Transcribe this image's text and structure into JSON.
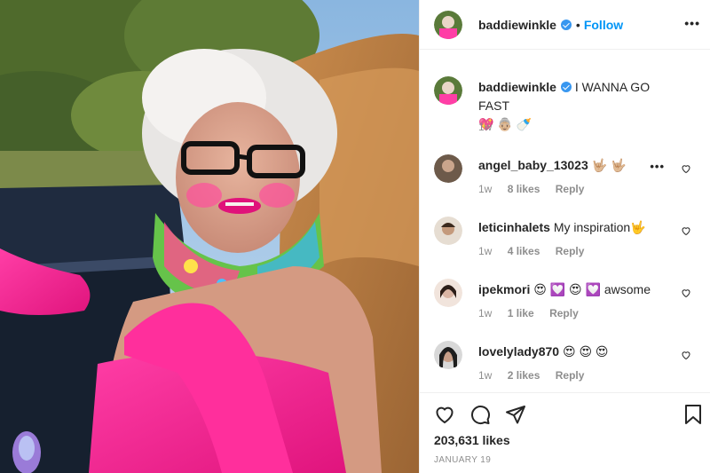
{
  "post": {
    "username": "baddiewinkle",
    "verified": true,
    "separator": "•",
    "follow_label": "Follow",
    "more_icon": "more-horizontal-icon",
    "caption": {
      "text": "I WANNA GO FAST",
      "emoji": "💖 👵🏼 🍼",
      "time": "1w"
    }
  },
  "comments": [
    {
      "username": "angel_baby_13023",
      "text": "🤟🏼 🤟🏼",
      "time": "1w",
      "likes": "8 likes",
      "reply": "Reply",
      "avatar_color": "#6d5a4a"
    },
    {
      "username": "leticinhalets",
      "text": "My inspiration🤟",
      "time": "1w",
      "likes": "4 likes",
      "reply": "Reply",
      "avatar_color": "#caa98a"
    },
    {
      "username": "ipekmori",
      "text": "😍 💟 😍 💟  awsome",
      "time": "1w",
      "likes": "1 like",
      "reply": "Reply",
      "avatar_color": "#d9b5a4"
    },
    {
      "username": "lovelylady870",
      "text": "😍 😍 😍",
      "time": "1w",
      "likes": "2 likes",
      "reply": "Reply",
      "avatar_color": "#3a3a3a"
    }
  ],
  "footer": {
    "likes": "203,631 likes",
    "date": "JANUARY 19",
    "icons": [
      "heart-icon",
      "comment-icon",
      "share-icon",
      "bookmark-icon"
    ]
  },
  "colors": {
    "accent": "#0095f6",
    "verified": "#3897f0",
    "muted": "#8e8e8e",
    "text": "#262626",
    "border": "#efefef"
  }
}
